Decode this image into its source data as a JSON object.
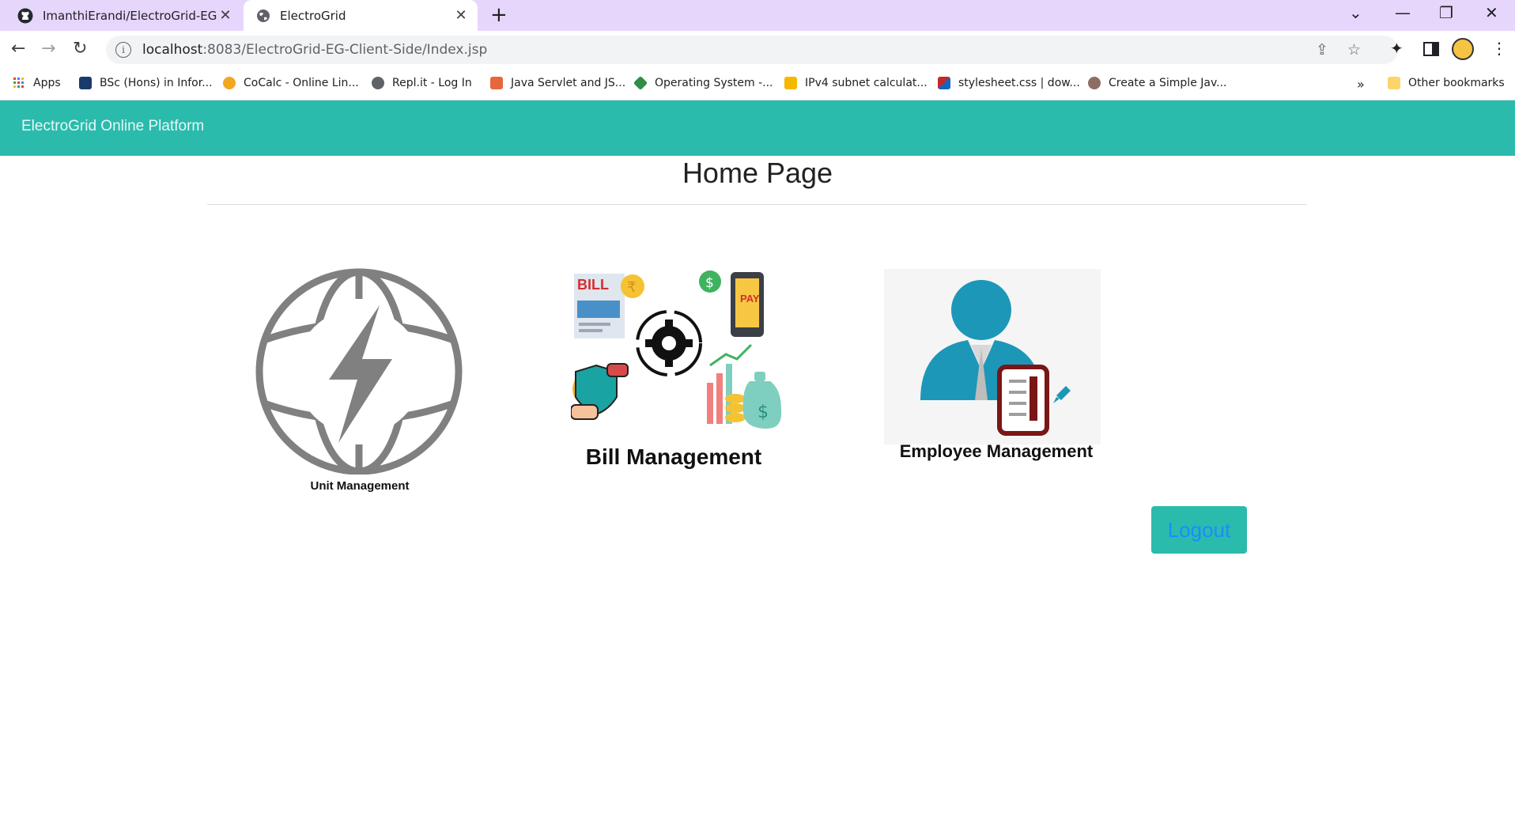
{
  "browser": {
    "tabs": [
      {
        "title": "ImanthiErandi/ElectroGrid-EG--Cl",
        "icon": "github-icon",
        "active": false
      },
      {
        "title": "ElectroGrid",
        "icon": "globe-icon",
        "active": true
      }
    ],
    "url_host": "localhost",
    "url_rest": ":8083/ElectroGrid-EG-Client-Side/Index.jsp",
    "bookmarks": [
      {
        "label": "Apps",
        "icon": "apps-grid-icon",
        "color": "#ea4335"
      },
      {
        "label": "BSc (Hons) in Infor...",
        "icon": "sliit-icon",
        "color": "#1a3a6b"
      },
      {
        "label": "CoCalc - Online Lin...",
        "icon": "cocalc-icon",
        "color": "#f4a623"
      },
      {
        "label": "Repl.it - Log In",
        "icon": "replit-icon",
        "color": "#5f6368"
      },
      {
        "label": "Java Servlet and JS...",
        "icon": "javatpoint-icon",
        "color": "#e8663d"
      },
      {
        "label": "Operating System -...",
        "icon": "gfg-icon",
        "color": "#2f8d46"
      },
      {
        "label": "IPv4 subnet calculat...",
        "icon": "amazon-icon",
        "color": "#f5b800"
      },
      {
        "label": "stylesheet.css | dow...",
        "icon": "colorful-icon",
        "color": "#c62828"
      },
      {
        "label": "Create a Simple Jav...",
        "icon": "person-icon",
        "color": "#8d6e63"
      }
    ],
    "overflow": "»",
    "other_bookmarks": "Other bookmarks"
  },
  "page": {
    "brand": "ElectroGrid Online Platform",
    "title": "Home Page",
    "cards": [
      {
        "name": "unit-management",
        "caption": "Unit Management"
      },
      {
        "name": "bill-management",
        "caption": "Bill Management",
        "badge": "BILL",
        "pay": "PAY"
      },
      {
        "name": "employee-management",
        "caption": "Employee Management"
      }
    ],
    "logout": "Logout"
  },
  "colors": {
    "navbar": "#2bbbad",
    "tabstrip": "#e6d6fb",
    "logout_text": "#1a8cff"
  }
}
